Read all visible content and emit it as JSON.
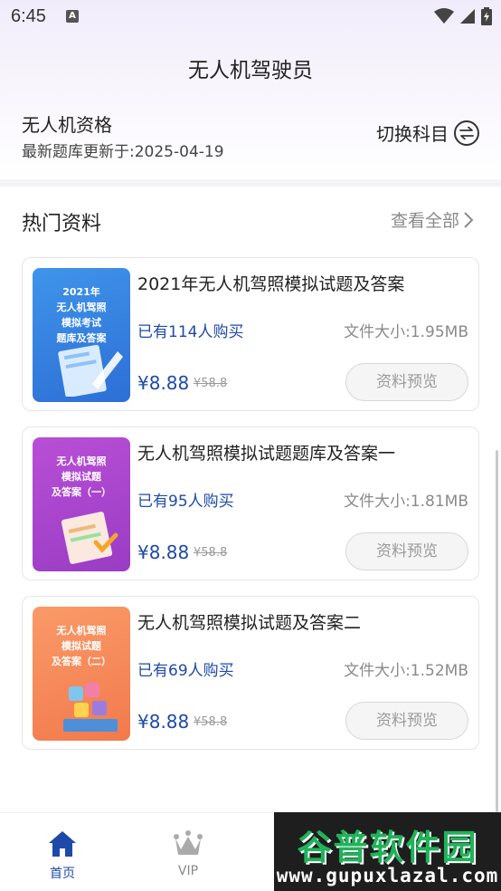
{
  "status_bar": {
    "time": "6:45",
    "a_badge": "A"
  },
  "header": {
    "title": "无人机驾驶员"
  },
  "subject": {
    "name": "无人机资格",
    "updated": "最新题库更新于:2025-04-19",
    "switch_label": "切换科目"
  },
  "section": {
    "title": "热门资料",
    "view_all": "查看全部"
  },
  "materials": [
    {
      "title": "2021年无人机驾照模拟试题及答案",
      "thumb_text": "2021年\n无人机驾照\n模拟考试\n题库及答案",
      "buyers": "已有114人购买",
      "size": "文件大小:1.95MB",
      "price": "¥8.88",
      "old_price": "¥58.8",
      "button": "资料预览"
    },
    {
      "title": "无人机驾照模拟试题题库及答案一",
      "thumb_text": "无人机驾照\n模拟试题\n及答案（一）",
      "buyers": "已有95人购买",
      "size": "文件大小:1.81MB",
      "price": "¥8.88",
      "old_price": "¥58.8",
      "button": "资料预览"
    },
    {
      "title": "无人机驾照模拟试题及答案二",
      "thumb_text": "无人机驾照\n模拟试题\n及答案（二）",
      "buyers": "已有69人购买",
      "size": "文件大小:1.52MB",
      "price": "¥8.88",
      "old_price": "¥58.8",
      "button": "资料预览"
    }
  ],
  "nav": {
    "home": "首页",
    "vip": "VIP"
  },
  "watermark": {
    "big": "谷普软件园",
    "small": "www.gupuxlazal.com"
  },
  "colors": {
    "accent": "#1d4aa8",
    "thumb1": "#3c8ee6",
    "thumb2": "#b04ad0",
    "thumb3": "#f58a5a"
  }
}
